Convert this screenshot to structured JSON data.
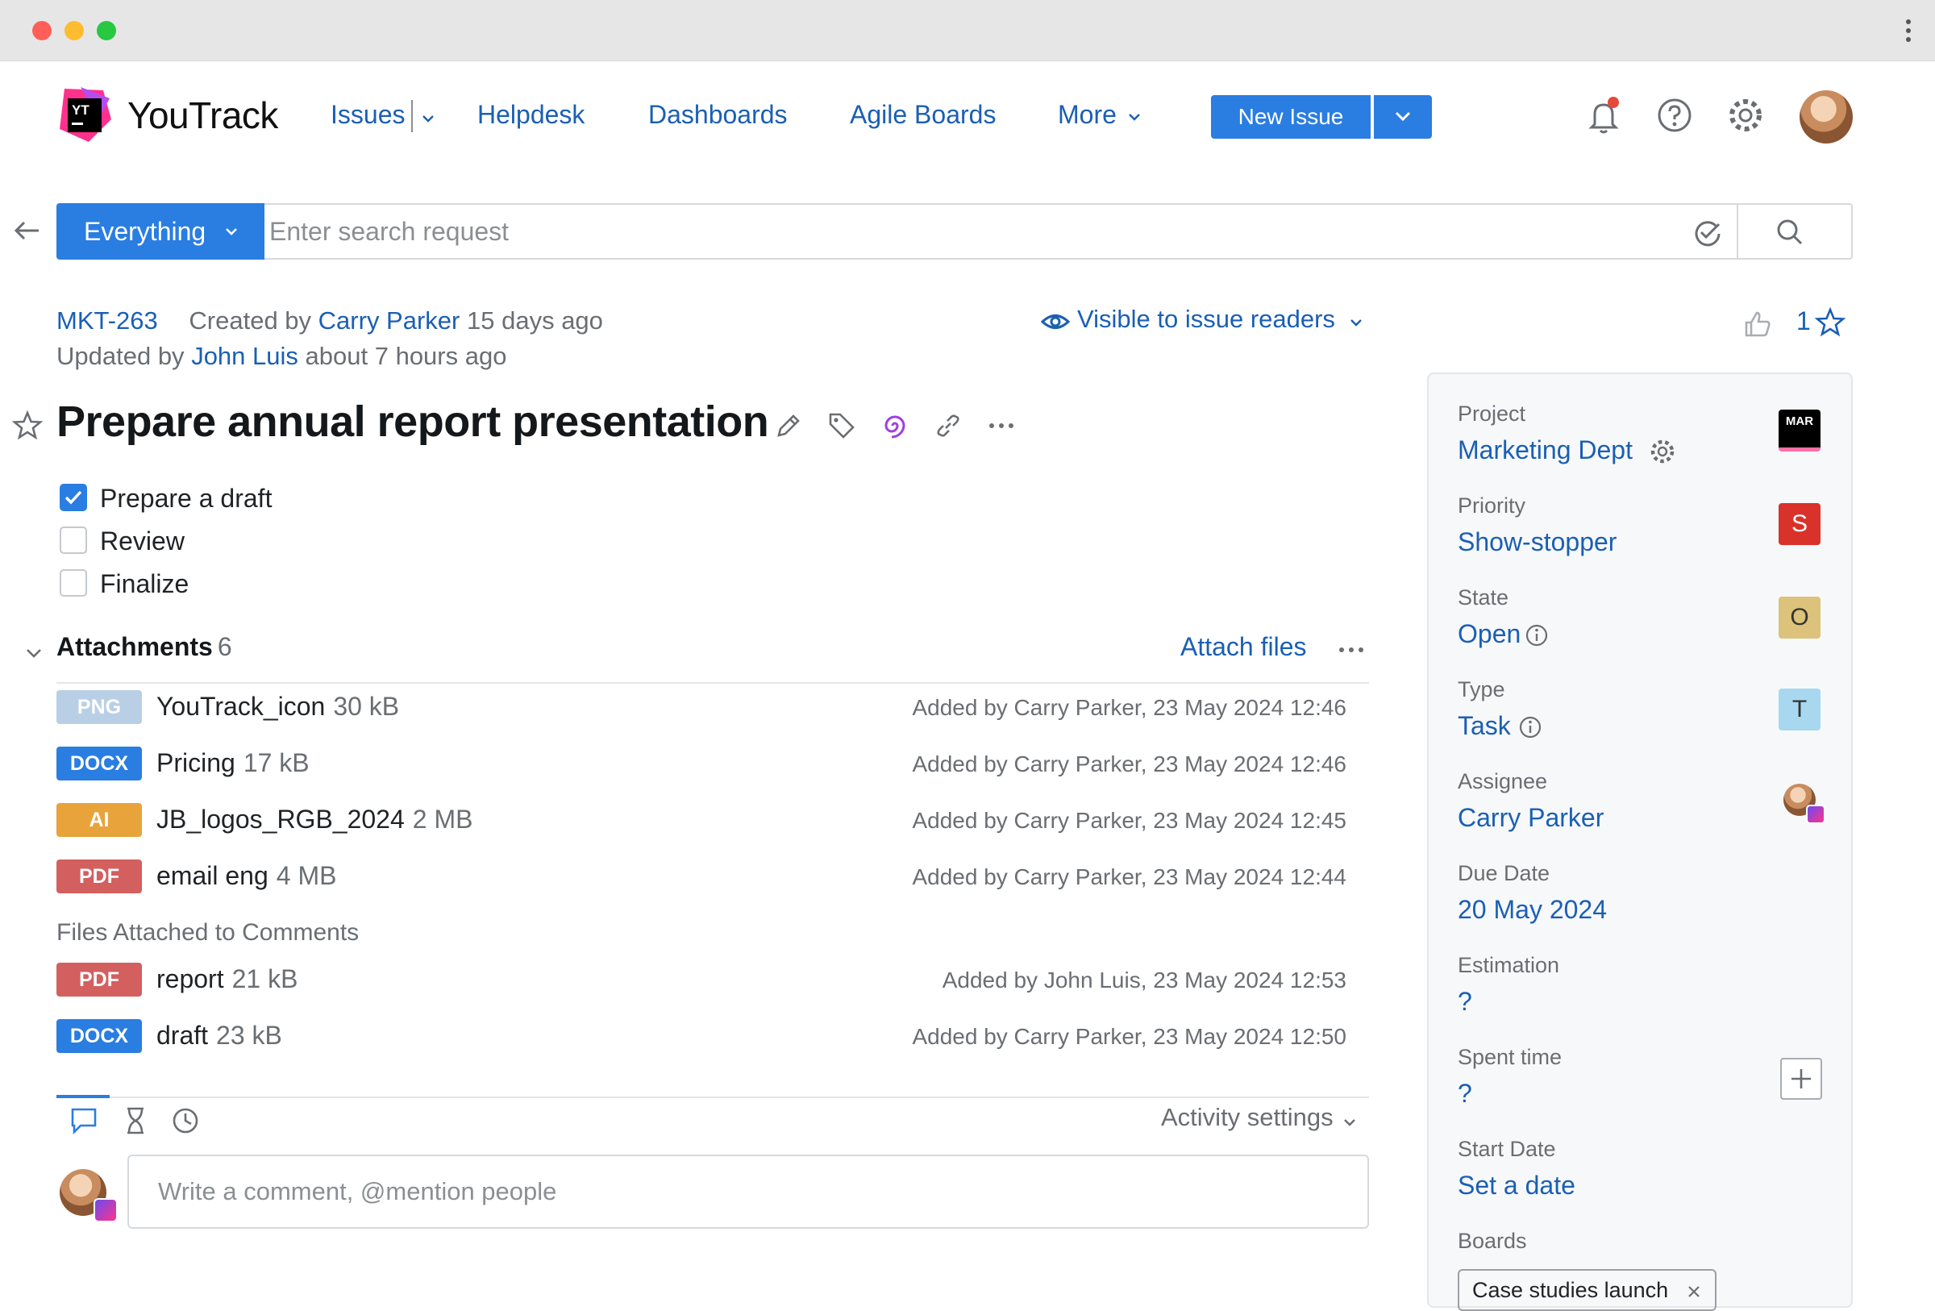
{
  "app": {
    "brand": "YouTrack",
    "logo_text": "YT"
  },
  "nav": {
    "issues": "Issues",
    "helpdesk": "Helpdesk",
    "dashboards": "Dashboards",
    "agile_boards": "Agile Boards",
    "more": "More",
    "new_issue": "New Issue"
  },
  "search": {
    "context": "Everything",
    "placeholder": "Enter search request"
  },
  "issue": {
    "id": "MKT-263",
    "created_prefix": "Created by",
    "created_by": "Carry Parker",
    "created_ago": "15 days ago",
    "updated_prefix": "Updated by",
    "updated_by": "John Luis",
    "updated_ago": "about 7 hours ago",
    "visibility": "Visible to issue readers",
    "star_count": "1",
    "title": "Prepare annual report presentation",
    "checklist": [
      {
        "label": "Prepare a draft",
        "checked": true
      },
      {
        "label": "Review",
        "checked": false
      },
      {
        "label": "Finalize",
        "checked": false
      }
    ]
  },
  "attachments": {
    "heading": "Attachments",
    "count": "6",
    "attach_label": "Attach files",
    "files": [
      {
        "type": "PNG",
        "color": "#b9cfe6",
        "name": "YouTrack_icon",
        "size": "30 kB",
        "added": "Added by Carry Parker, 23 May 2024 12:46"
      },
      {
        "type": "DOCX",
        "color": "#2a7de1",
        "name": "Pricing",
        "size": "17 kB",
        "added": "Added by Carry Parker, 23 May 2024 12:46"
      },
      {
        "type": "AI",
        "color": "#e8a33b",
        "name": "JB_logos_RGB_2024",
        "size": "2 MB",
        "added": "Added by Carry Parker, 23 May 2024 12:45"
      },
      {
        "type": "PDF",
        "color": "#d35f5f",
        "name": "email eng",
        "size": "4 MB",
        "added": "Added by Carry Parker, 23 May 2024 12:44"
      }
    ],
    "comment_files_heading": "Files Attached to Comments",
    "comment_files": [
      {
        "type": "PDF",
        "color": "#d35f5f",
        "name": "report",
        "size": "21 kB",
        "added": "Added by John Luis, 23 May 2024 12:53"
      },
      {
        "type": "DOCX",
        "color": "#2a7de1",
        "name": "draft",
        "size": "23 kB",
        "added": "Added by Carry Parker, 23 May 2024 12:50"
      }
    ]
  },
  "activity": {
    "settings_label": "Activity settings",
    "comment_placeholder": "Write a comment, @mention people"
  },
  "fields": {
    "project": {
      "label": "Project",
      "value": "Marketing Dept",
      "badge": "MAR"
    },
    "priority": {
      "label": "Priority",
      "value": "Show-stopper",
      "badge": "S",
      "badge_color": "#d9322b"
    },
    "state": {
      "label": "State",
      "value": "Open",
      "badge": "O",
      "badge_color": "#dcc27a"
    },
    "type": {
      "label": "Type",
      "value": "Task",
      "badge": "T",
      "badge_color": "#a7d8f0"
    },
    "assignee": {
      "label": "Assignee",
      "value": "Carry Parker"
    },
    "due_date": {
      "label": "Due Date",
      "value": "20 May 2024"
    },
    "estimation": {
      "label": "Estimation",
      "value": "?"
    },
    "spent_time": {
      "label": "Spent time",
      "value": "?"
    },
    "start_date": {
      "label": "Start Date",
      "value": "Set a date"
    },
    "boards": {
      "label": "Boards",
      "tag": "Case studies launch"
    }
  }
}
